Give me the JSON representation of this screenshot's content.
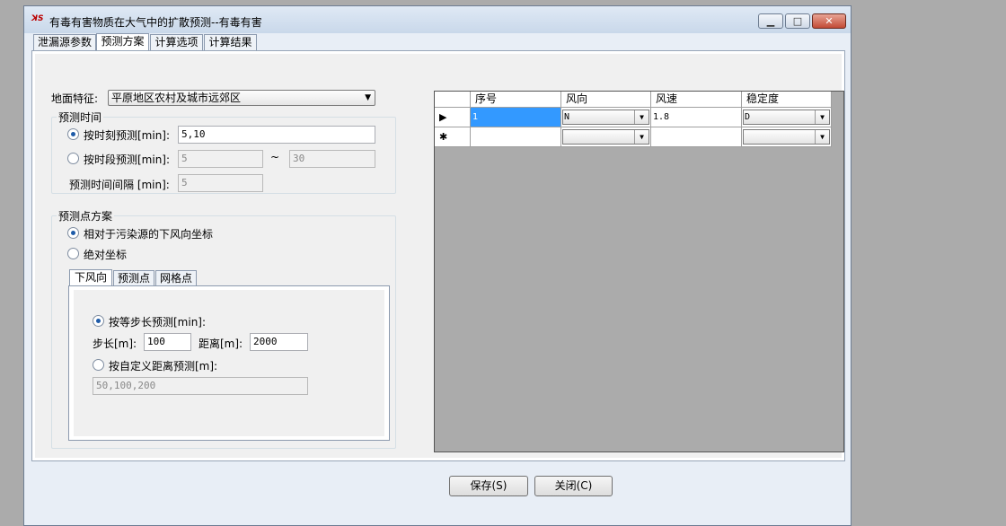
{
  "window": {
    "title": "有毒有害物质在大气中的扩散预测--有毒有害",
    "app_icon": "app-icon"
  },
  "tabs": [
    {
      "label": "泄漏源参数",
      "active": false
    },
    {
      "label": "预测方案",
      "active": true
    },
    {
      "label": "计算选项",
      "active": false
    },
    {
      "label": "计算结果",
      "active": false
    }
  ],
  "ground": {
    "label": "地面特征:",
    "value": "平原地区农村及城市远郊区"
  },
  "time": {
    "group_title": "预测时间",
    "moment_label": "按时刻预测[min]:",
    "moment_value": "5,10",
    "moment_checked": true,
    "period_label": "按时段预测[min]:",
    "period_start": "5",
    "period_sep": "~",
    "period_end": "30",
    "interval_label": "预测时间间隔 [min]:",
    "interval_value": "5"
  },
  "points": {
    "group_title": "预测点方案",
    "relative_label": "相对于污染源的下风向坐标",
    "relative_checked": true,
    "absolute_label": "绝对坐标",
    "subtabs": [
      "下风向",
      "预测点",
      "网格点"
    ],
    "equal_step_label": "按等步长预测[min]:",
    "equal_step_checked": true,
    "step_label": "步长[m]:",
    "step_value": "100",
    "distance_label": "距离[m]:",
    "distance_value": "2000",
    "custom_label": "按自定义距离预测[m]:",
    "custom_value": "50,100,200"
  },
  "grid": {
    "headers": [
      "序号",
      "风向",
      "风速",
      "稳定度"
    ],
    "rows": [
      {
        "marker": "▶",
        "seq": "1",
        "direction": "N",
        "speed": "1.8",
        "stability": "D"
      },
      {
        "marker": "✱",
        "seq": "",
        "direction": "",
        "speed": "",
        "stability": ""
      }
    ]
  },
  "buttons": {
    "save": "保存(S)",
    "close": "关闭(C)"
  }
}
